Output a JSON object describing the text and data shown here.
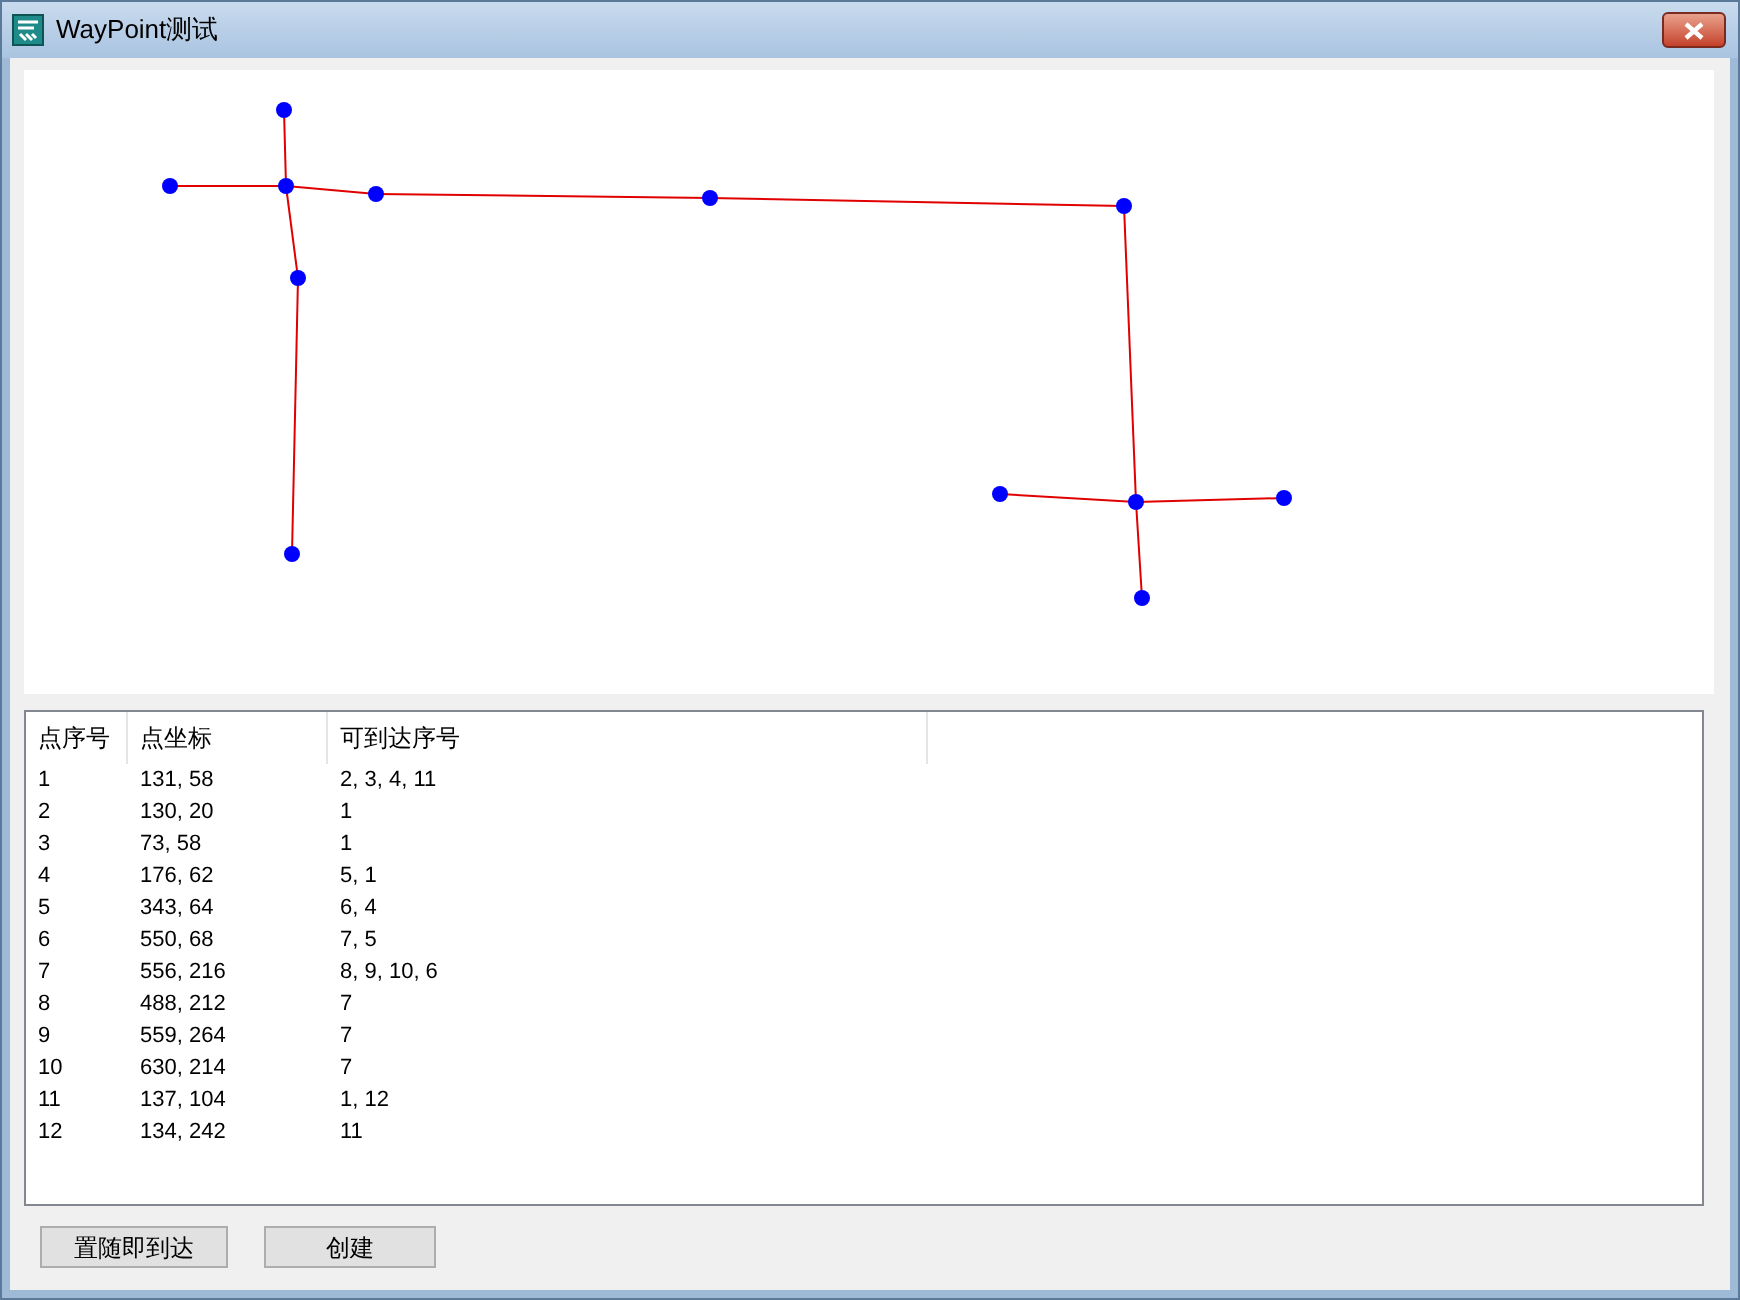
{
  "window": {
    "title": "WayPoint测试"
  },
  "table": {
    "columns": [
      "点序号",
      "点坐标",
      "可到达序号"
    ],
    "rows": [
      [
        "1",
        "131, 58",
        "2, 3, 4, 11"
      ],
      [
        "2",
        "130, 20",
        "1"
      ],
      [
        "3",
        "73, 58",
        "1"
      ],
      [
        "4",
        "176, 62",
        "5, 1"
      ],
      [
        "5",
        "343, 64",
        "6, 4"
      ],
      [
        "6",
        "550, 68",
        "7, 5"
      ],
      [
        "7",
        "556, 216",
        "8, 9, 10, 6"
      ],
      [
        "8",
        "488, 212",
        "7"
      ],
      [
        "9",
        "559, 264",
        "7"
      ],
      [
        "10",
        "630, 214",
        "7"
      ],
      [
        "11",
        "137, 104",
        "1, 12"
      ],
      [
        "12",
        "134, 242",
        "11"
      ]
    ]
  },
  "buttons": [
    "置随即到达",
    "创建"
  ]
}
